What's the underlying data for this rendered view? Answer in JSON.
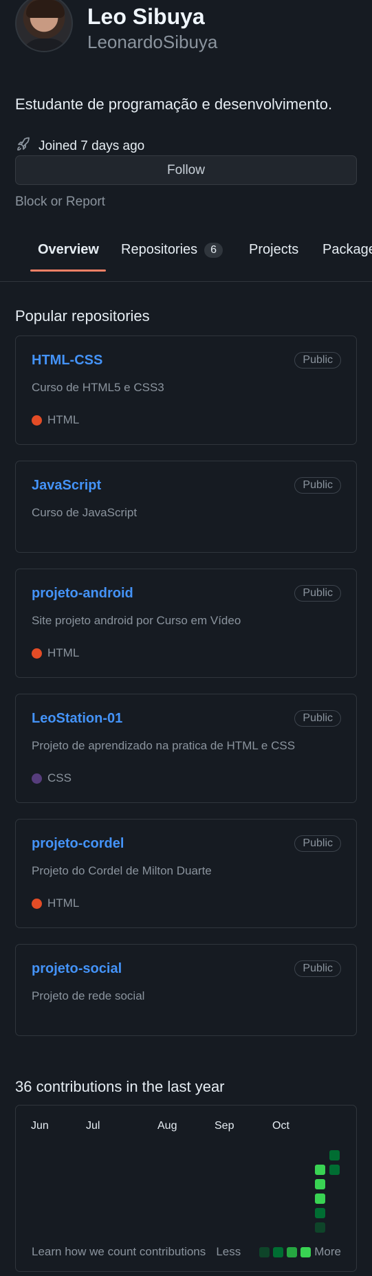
{
  "profile": {
    "name": "Leo Sibuya",
    "login": "LeonardoSibuya",
    "bio": "Estudante de programação e desenvolvimento.",
    "joined": "Joined 7 days ago",
    "follow_label": "Follow",
    "block_label": "Block or Report"
  },
  "tabs": [
    {
      "label": "Overview"
    },
    {
      "label": "Repositories",
      "count": "6"
    },
    {
      "label": "Projects"
    },
    {
      "label": "Packages"
    }
  ],
  "popular": {
    "title": "Popular repositories",
    "repos": [
      {
        "name": "HTML-CSS",
        "visibility": "Public",
        "description": "Curso de HTML5 e CSS3",
        "language": "HTML",
        "language_color": "#e34c26"
      },
      {
        "name": "JavaScript",
        "visibility": "Public",
        "description": "Curso de JavaScript",
        "language": "",
        "language_color": ""
      },
      {
        "name": "projeto-android",
        "visibility": "Public",
        "description": "Site projeto android por Curso em Vídeo",
        "language": "HTML",
        "language_color": "#e34c26"
      },
      {
        "name": "LeoStation-01",
        "visibility": "Public",
        "description": "Projeto de aprendizado na pratica de HTML e CSS",
        "language": "CSS",
        "language_color": "#563d7c"
      },
      {
        "name": "projeto-cordel",
        "visibility": "Public",
        "description": "Projeto do Cordel de Milton Duarte",
        "language": "HTML",
        "language_color": "#e34c26"
      },
      {
        "name": "projeto-social",
        "visibility": "Public",
        "description": "Projeto de rede social",
        "language": "",
        "language_color": ""
      }
    ]
  },
  "contributions": {
    "title": "36 contributions in the last year",
    "months": [
      "Jun",
      "Jul",
      "Aug",
      "Sep",
      "Oct"
    ],
    "learn_label": "Learn how we count contributions",
    "less_label": "Less",
    "more_label": "More",
    "levels": [
      "#0e4429",
      "#006d32",
      "#26a641",
      "#39d353"
    ]
  },
  "colors": {
    "accent": "#4493f8",
    "tab_underline": "#f78166",
    "background": "#161b22"
  }
}
